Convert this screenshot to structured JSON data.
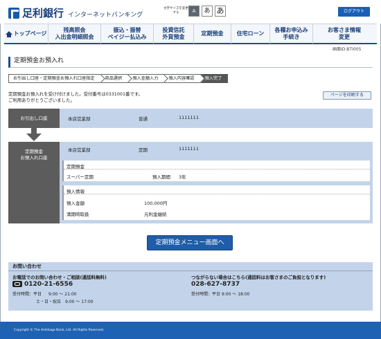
{
  "header": {
    "bank_name": "足利銀行",
    "service_name": "インターネットバンキング",
    "font_size_label": "文字サイズを変更する",
    "font_size_small": "A",
    "font_size_medium": "あ",
    "font_size_large": "あ",
    "logout_label": "ログアウト"
  },
  "nav": {
    "items": [
      {
        "line1": "トップページ",
        "line2": ""
      },
      {
        "line1": "残高照会",
        "line2": "入出金明細照会"
      },
      {
        "line1": "振込・振替",
        "line2": "ペイジー払込み"
      },
      {
        "line1": "投資信託",
        "line2": "外貨預金"
      },
      {
        "line1": "定期預金",
        "line2": ""
      },
      {
        "line1": "住宅ローン",
        "line2": ""
      },
      {
        "line1": "各種お申込み",
        "line2": "手続き"
      },
      {
        "line1": "お客さま情報",
        "line2": "変更"
      }
    ]
  },
  "screen_id": "画面ID:BTI005",
  "page_title": "定期預金お預入れ",
  "steps": [
    "お引出し口座・定期預金お預入れ口座指定",
    "商品選択",
    "預入金額入力",
    "預入内容確認",
    "預入完了"
  ],
  "message": {
    "line1": "定期預金お預入れを受け付けました。受付番号は0331001番です。",
    "line2": "ご利用ありがとうございました。"
  },
  "print_button": "ページを印刷する",
  "withdraw": {
    "label": "お引出し口座",
    "branch": "本店営業部",
    "type": "普通",
    "account_number": "1111111"
  },
  "deposit": {
    "label_line1": "定期預金",
    "label_line2": "お預入れ口座",
    "branch": "本店営業部",
    "type": "定期",
    "account_number": "1111111",
    "product_header": "定期預金",
    "product_name": "スーパー定期",
    "period_label": "預入期間",
    "period_value": "3年",
    "info_header": "預入情報",
    "amount_label": "預入金額",
    "amount_value": "100,000円",
    "maturity_label": "満期時取扱",
    "maturity_value": "元利金継続"
  },
  "menu_button": "定期預金メニュー画面へ",
  "contact": {
    "title": "お問い合わせ",
    "left_heading": "お電話でのお問い合わせ・ご相談(通話料無料)",
    "phone": "0120-21-6556",
    "hours_weekday_label": "受付時間：平日",
    "hours_weekday": "9:00 ～ 21:00",
    "hours_weekend_label": "土・日・祝日",
    "hours_weekend": "9:00 ～ 17:00",
    "right_heading": "つながらない場合はこちら(通話料はお客さまのご負担となります)",
    "alt_phone": "028-627-8737",
    "alt_hours": "受付時間：平日 9:00 ～ 18:00"
  },
  "footer": "Copyright © The Ashikaga Bank, Ltd. All Rights Reserved."
}
